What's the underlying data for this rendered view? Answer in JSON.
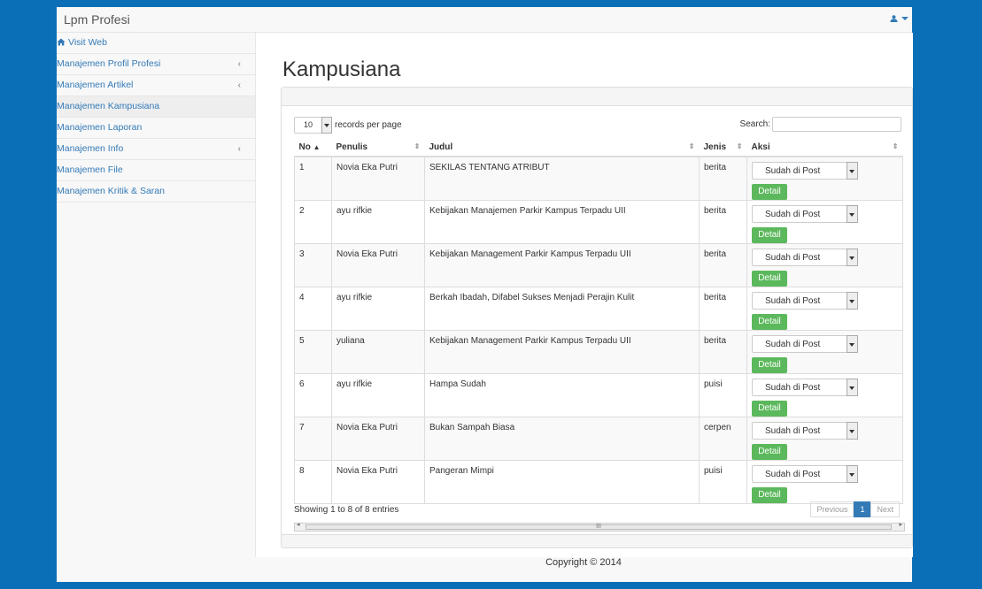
{
  "app": {
    "brand": "Lpm Profesi",
    "user_icon": "user-icon"
  },
  "sidebar": {
    "items": [
      {
        "label": "Visit Web",
        "icon": "home-icon",
        "arrow": ""
      },
      {
        "label": "Manajemen Profil Profesi",
        "arrow": "‹"
      },
      {
        "label": "Manajemen Artikel",
        "arrow": "‹"
      },
      {
        "label": "Manajemen Kampusiana",
        "arrow": ""
      },
      {
        "label": "Manajemen Laporan",
        "arrow": ""
      },
      {
        "label": "Manajemen Info",
        "arrow": "‹"
      },
      {
        "label": "Manajemen File",
        "arrow": ""
      },
      {
        "label": "Manajemen Kritik & Saran",
        "arrow": ""
      }
    ]
  },
  "page": {
    "title": "Kampusiana"
  },
  "table_controls": {
    "length_value": "10",
    "length_label": "records per page",
    "search_label": "Search:"
  },
  "table": {
    "headers": [
      "No",
      "Penulis",
      "Judul",
      "Jenis",
      "Aksi"
    ],
    "status_value": "Sudah di Post",
    "detail_label": "Detail",
    "rows": [
      {
        "no": "1",
        "penulis": "Novia Eka Putri",
        "judul": "SEKILAS TENTANG ATRIBUT",
        "jenis": "berita"
      },
      {
        "no": "2",
        "penulis": "ayu rifkie",
        "judul": "Kebijakan Manajemen Parkir Kampus Terpadu UII",
        "jenis": "berita"
      },
      {
        "no": "3",
        "penulis": "Novia Eka Putri",
        "judul": "Kebijakan Management Parkir Kampus Terpadu UII",
        "jenis": "berita"
      },
      {
        "no": "4",
        "penulis": "ayu rifkie",
        "judul": "Berkah Ibadah, Difabel Sukses Menjadi Perajin Kulit",
        "jenis": "berita"
      },
      {
        "no": "5",
        "penulis": "yuliana",
        "judul": "Kebijakan Management Parkir Kampus Terpadu UII",
        "jenis": "berita"
      },
      {
        "no": "6",
        "penulis": "ayu rifkie",
        "judul": "Hampa Sudah",
        "jenis": "puisi"
      },
      {
        "no": "7",
        "penulis": "Novia Eka Putri",
        "judul": "Bukan Sampah Biasa",
        "jenis": "cerpen"
      },
      {
        "no": "8",
        "penulis": "Novia Eka Putri",
        "judul": "Pangeran Mimpi",
        "jenis": "puisi"
      }
    ]
  },
  "pagination": {
    "info": "Showing 1 to 8 of 8 entries",
    "previous": "Previous",
    "current": "1",
    "next": "Next"
  },
  "scrollbar": {
    "thumb": "III"
  },
  "footer": {
    "copyright": "Copyright © 2014"
  }
}
